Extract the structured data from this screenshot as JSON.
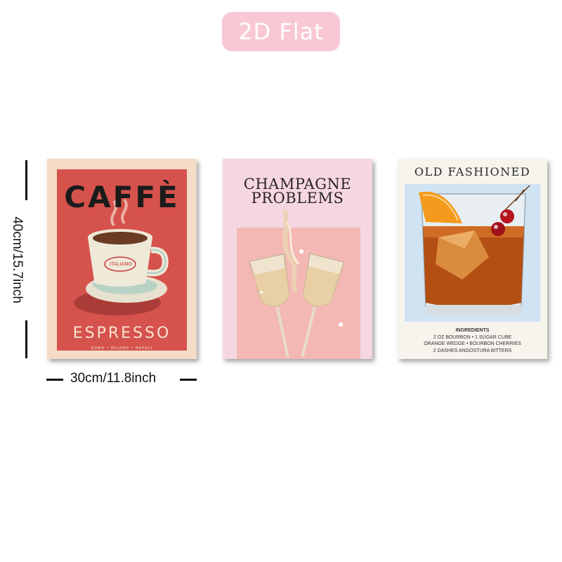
{
  "badge": {
    "label": "2D Flat",
    "color": "#f8c9d4"
  },
  "dimensions": {
    "height_label": "40cm/15.7inch",
    "width_label": "30cm/11.8inch"
  },
  "posters": [
    {
      "title": "CAFFÈ",
      "cup_label": "ITALIANO",
      "subtitle": "ESPRESSO",
      "cities": "ROMA • MILANO • NAPOLI",
      "colors": {
        "background": "#f4dcc6",
        "panel": "#d6524c"
      }
    },
    {
      "title_line1": "CHAMPAGNE",
      "title_line2": "PROBLEMS",
      "colors": {
        "background": "#f6d6e2",
        "panel": "#f4b8b4"
      }
    },
    {
      "title": "OLD FASHIONED",
      "ingredients_heading": "INGREDIENTS",
      "ingredients": [
        "2 OZ BOURBON • 1 SUGAR CUBE",
        "ORANGE WEDGE • BOURBON CHERRIES",
        "2 DASHES ANGOSTURA BITTERS"
      ],
      "colors": {
        "background": "#f7f4ee",
        "panel": "#cfe3f3"
      }
    }
  ]
}
